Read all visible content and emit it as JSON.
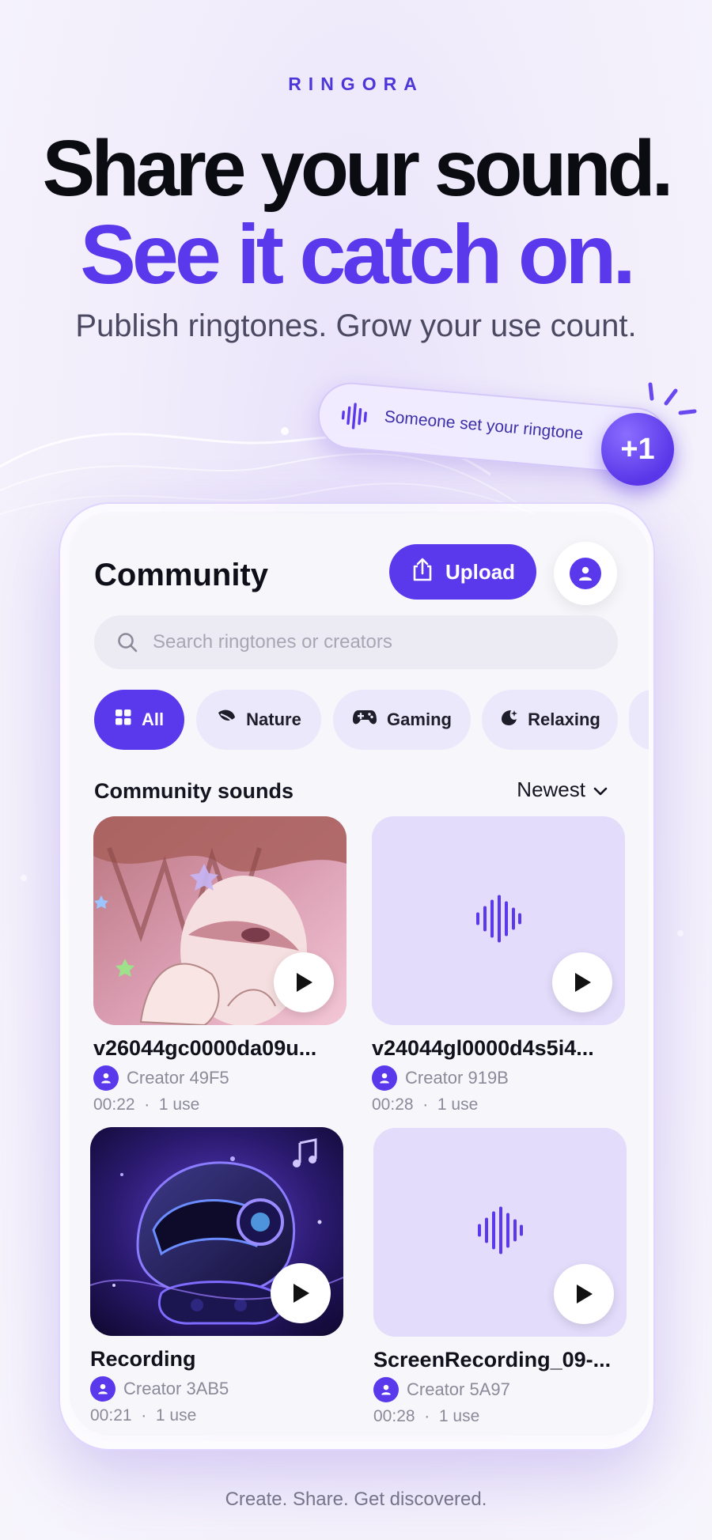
{
  "brand": "RINGORA",
  "headline": {
    "line1": "Share your sound.",
    "line2": "See it catch on."
  },
  "subheadline": "Publish ringtones. Grow your use count.",
  "toast": {
    "text": "Someone set your ringtone",
    "badge": "+1",
    "icon": "waveform-icon"
  },
  "app": {
    "title": "Community",
    "upload_label": "Upload",
    "search": {
      "placeholder": "Search ringtones or creators",
      "value": ""
    },
    "chips": [
      {
        "label": "All",
        "icon": "grid-icon",
        "active": true
      },
      {
        "label": "Nature",
        "icon": "leaf-icon",
        "active": false
      },
      {
        "label": "Gaming",
        "icon": "gamepad-icon",
        "active": false
      },
      {
        "label": "Relaxing",
        "icon": "moon-icon",
        "active": false
      }
    ],
    "section_title": "Community sounds",
    "sort_label": "Newest",
    "cards": [
      {
        "title": "v26044gc0000da09u...",
        "creator": "Creator 49F5",
        "duration": "00:22",
        "uses": "1 use",
        "thumb": "anime-art"
      },
      {
        "title": "v24044gl0000d4s5i4...",
        "creator": "Creator 919B",
        "duration": "00:28",
        "uses": "1 use",
        "thumb": "waveform"
      },
      {
        "title": "Recording",
        "creator": "Creator 3AB5",
        "duration": "00:21",
        "uses": "1 use",
        "thumb": "robot-art"
      },
      {
        "title": "ScreenRecording_09-...",
        "creator": "Creator 5A97",
        "duration": "00:28",
        "uses": "1 use",
        "thumb": "waveform"
      }
    ],
    "meta_separator": "·"
  },
  "footer": "Create. Share. Get discovered.",
  "colors": {
    "accent": "#5a38ec",
    "headline_dark": "#0b0b12",
    "chip_bg": "#ece8fb",
    "card_placeholder": "#e3dcfb"
  }
}
